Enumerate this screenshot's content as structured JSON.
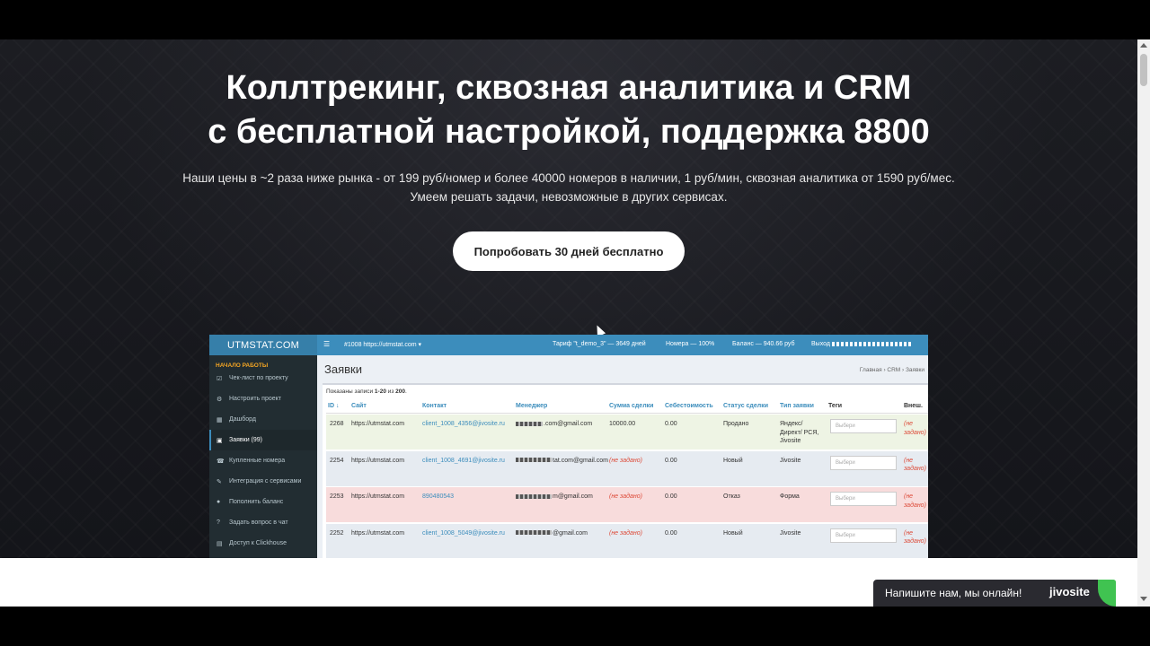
{
  "hero": {
    "title_line1": "Коллтрекинг, сквозная аналитика и CRM",
    "title_line2": "с бесплатной настройкой, поддержка 8800",
    "subtitle_line1": "Наши цены в ~2 раза ниже рынка - от 199 руб/номер и более 40000 номеров в наличии, 1 руб/мин, сквозная аналитика от 1590 руб/мес.",
    "subtitle_line2": "Умеем решать задачи, невозможные в других сервисах.",
    "cta_label": "Попробовать 30 дней бесплатно"
  },
  "app": {
    "logo": "UTMSTAT.COM",
    "menu_icon": "☰",
    "project": "#1008 https://utmstat.com ▾",
    "tariff": "Тариф \"t_demo_3\" — 3649 дней",
    "numbers": "Номера — 100%",
    "balance": "Баланс — 940.66 руб",
    "logout": "Выход",
    "sidebar_header": "НАЧАЛО РАБОТЫ",
    "sidebar": [
      {
        "icon": "☑",
        "label": "Чек-лист по проекту"
      },
      {
        "icon": "⚙",
        "label": "Настроить проект"
      },
      {
        "icon": "▦",
        "label": "Дашборд"
      },
      {
        "icon": "▣",
        "label": "Заявки (99)"
      },
      {
        "icon": "☎",
        "label": "Купленные номера"
      },
      {
        "icon": "✎",
        "label": "Интеграция с сервисами"
      },
      {
        "icon": "●",
        "label": "Пополнить баланс"
      },
      {
        "icon": "?",
        "label": "Задать вопрос в чат"
      },
      {
        "icon": "▤",
        "label": "Доступ к Clickhouse"
      }
    ],
    "page_title": "Заявки",
    "breadcrumb": "Главная  ›  CRM  ›  Заявки",
    "shown_prefix": "Показаны записи ",
    "shown_range": "1-20",
    "shown_mid": " из ",
    "shown_total": "200",
    "shown_suffix": ".",
    "columns": [
      "ID ↓",
      "Сайт",
      "Контакт",
      "Менеджер",
      "Сумма сделки",
      "Себестоимость",
      "Статус сделки",
      "Тип заявки",
      "Теги",
      "Внеш."
    ],
    "rows": [
      {
        "id": "2268",
        "site": "https://utmstat.com",
        "contact": "client_1008_4356@jivosite.ru",
        "manager": ".com@gmail.com",
        "sum": "10000.00",
        "cost": "0.00",
        "status": "Продано",
        "type": "Яндекс/ Директ/ РСЯ, Jivosite",
        "tag": "Выбери",
        "ext": "(не задано)",
        "bg": "#eef4e4",
        "sum_red": false
      },
      {
        "id": "2254",
        "site": "https://utmstat.com",
        "contact": "client_1008_4691@jivosite.ru",
        "manager": "tat.com@gmail.com",
        "sum": "(не задано)",
        "cost": "0.00",
        "status": "Новый",
        "type": "Jivosite",
        "tag": "Выбери",
        "ext": "(не задано)",
        "bg": "#e6ebf1",
        "sum_red": true
      },
      {
        "id": "2253",
        "site": "https://utmstat.com",
        "contact": "890480543",
        "manager": "m@gmail.com",
        "sum": "(не задано)",
        "cost": "0.00",
        "status": "Отказ",
        "type": "Форма",
        "tag": "Выбери",
        "ext": "(не задано)",
        "bg": "#f8dcdc",
        "sum_red": true
      },
      {
        "id": "2252",
        "site": "https://utmstat.com",
        "contact": "client_1008_5049@jivosite.ru",
        "manager": "@gmail.com",
        "sum": "(не задано)",
        "cost": "0.00",
        "status": "Новый",
        "type": "Jivosite",
        "tag": "Выбери",
        "ext": "(не задано)",
        "bg": "#e6ebf1",
        "sum_red": true
      }
    ]
  },
  "chat": {
    "text": "Напишите нам, мы онлайн!",
    "logo": "jivosite"
  },
  "colors": {
    "app_header": "#3c8dbc",
    "sidebar": "#222d32",
    "chat_accent": "#40c351"
  }
}
